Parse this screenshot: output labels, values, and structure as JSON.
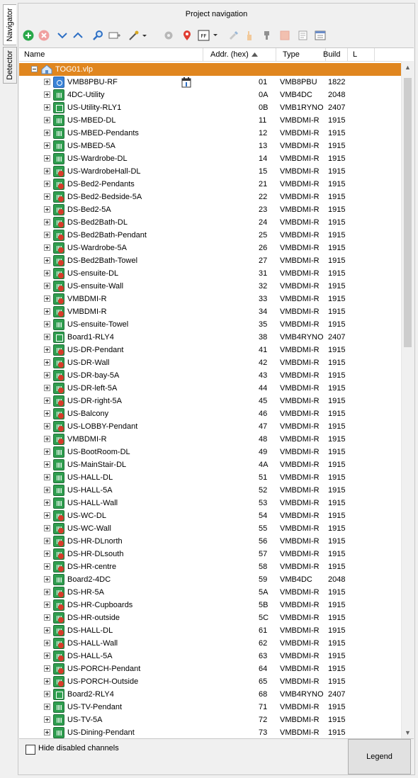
{
  "side_tabs": [
    "Navigator",
    "Detector"
  ],
  "panel_title": "Project navigation",
  "toolbar": {
    "icons": [
      "add-icon",
      "delete-icon",
      "move-down-icon",
      "move-up-icon",
      "search-icon",
      "scan-icon",
      "wand-icon",
      "gear-icon",
      "location-pin-icon",
      "firmware-icon",
      "brush-icon",
      "hand-icon",
      "stamp-icon",
      "memory-icon",
      "edit-form-icon",
      "print-window-icon"
    ],
    "ff_label": "FF"
  },
  "columns": {
    "name": "Name",
    "addr": "Addr. (hex)",
    "type": "Type",
    "build": "Build",
    "l": "L"
  },
  "root": {
    "name": "TOG01.vlp"
  },
  "rows": [
    {
      "name": "VMB8PBU-RF",
      "addr": "01",
      "type": "VMB8PBU",
      "build": "1822",
      "icon": "pbu",
      "cal": true
    },
    {
      "name": "4DC-Utility",
      "addr": "0A",
      "type": "VMB4DC",
      "build": "2048",
      "icon": "dim"
    },
    {
      "name": "US-Utility-RLY1",
      "addr": "0B",
      "type": "VMB1RYNO",
      "build": "2407",
      "icon": "rly"
    },
    {
      "name": "US-MBED-DL",
      "addr": "11",
      "type": "VMBDMI-R",
      "build": "1915",
      "icon": "dim"
    },
    {
      "name": "US-MBED-Pendants",
      "addr": "12",
      "type": "VMBDMI-R",
      "build": "1915",
      "icon": "dim"
    },
    {
      "name": "US-MBED-5A",
      "addr": "13",
      "type": "VMBDMI-R",
      "build": "1915",
      "icon": "dim"
    },
    {
      "name": "US-Wardrobe-DL",
      "addr": "14",
      "type": "VMBDMI-R",
      "build": "1915",
      "icon": "dim"
    },
    {
      "name": "US-WardrobeHall-DL",
      "addr": "15",
      "type": "VMBDMI-R",
      "build": "1915",
      "icon": "dimred"
    },
    {
      "name": "DS-Bed2-Pendants",
      "addr": "21",
      "type": "VMBDMI-R",
      "build": "1915",
      "icon": "dimred"
    },
    {
      "name": "DS-Bed2-Bedside-5A",
      "addr": "22",
      "type": "VMBDMI-R",
      "build": "1915",
      "icon": "dimred"
    },
    {
      "name": "DS-Bed2-5A",
      "addr": "23",
      "type": "VMBDMI-R",
      "build": "1915",
      "icon": "dimred"
    },
    {
      "name": "DS-Bed2Bath-DL",
      "addr": "24",
      "type": "VMBDMI-R",
      "build": "1915",
      "icon": "dimred"
    },
    {
      "name": "DS-Bed2Bath-Pendant",
      "addr": "25",
      "type": "VMBDMI-R",
      "build": "1915",
      "icon": "dimred"
    },
    {
      "name": "US-Wardrobe-5A",
      "addr": "26",
      "type": "VMBDMI-R",
      "build": "1915",
      "icon": "dimred"
    },
    {
      "name": "DS-Bed2Bath-Towel",
      "addr": "27",
      "type": "VMBDMI-R",
      "build": "1915",
      "icon": "dimred"
    },
    {
      "name": "US-ensuite-DL",
      "addr": "31",
      "type": "VMBDMI-R",
      "build": "1915",
      "icon": "dimred"
    },
    {
      "name": "US-ensuite-Wall",
      "addr": "32",
      "type": "VMBDMI-R",
      "build": "1915",
      "icon": "dimred"
    },
    {
      "name": "VMBDMI-R",
      "addr": "33",
      "type": "VMBDMI-R",
      "build": "1915",
      "icon": "dimred"
    },
    {
      "name": "VMBDMI-R",
      "addr": "34",
      "type": "VMBDMI-R",
      "build": "1915",
      "icon": "dimred"
    },
    {
      "name": "US-ensuite-Towel",
      "addr": "35",
      "type": "VMBDMI-R",
      "build": "1915",
      "icon": "dim"
    },
    {
      "name": "Board1-RLY4",
      "addr": "38",
      "type": "VMB4RYNO",
      "build": "2407",
      "icon": "rly"
    },
    {
      "name": "US-DR-Pendant",
      "addr": "41",
      "type": "VMBDMI-R",
      "build": "1915",
      "icon": "dimred"
    },
    {
      "name": "US-DR-Wall",
      "addr": "42",
      "type": "VMBDMI-R",
      "build": "1915",
      "icon": "dimred"
    },
    {
      "name": "US-DR-bay-5A",
      "addr": "43",
      "type": "VMBDMI-R",
      "build": "1915",
      "icon": "dimred"
    },
    {
      "name": "US-DR-left-5A",
      "addr": "44",
      "type": "VMBDMI-R",
      "build": "1915",
      "icon": "dimred"
    },
    {
      "name": "US-DR-right-5A",
      "addr": "45",
      "type": "VMBDMI-R",
      "build": "1915",
      "icon": "dimred"
    },
    {
      "name": "US-Balcony",
      "addr": "46",
      "type": "VMBDMI-R",
      "build": "1915",
      "icon": "dimred"
    },
    {
      "name": "US-LOBBY-Pendant",
      "addr": "47",
      "type": "VMBDMI-R",
      "build": "1915",
      "icon": "dimred"
    },
    {
      "name": "VMBDMI-R",
      "addr": "48",
      "type": "VMBDMI-R",
      "build": "1915",
      "icon": "dimred"
    },
    {
      "name": "US-BootRoom-DL",
      "addr": "49",
      "type": "VMBDMI-R",
      "build": "1915",
      "icon": "dim"
    },
    {
      "name": "US-MainStair-DL",
      "addr": "4A",
      "type": "VMBDMI-R",
      "build": "1915",
      "icon": "dim"
    },
    {
      "name": "US-HALL-DL",
      "addr": "51",
      "type": "VMBDMI-R",
      "build": "1915",
      "icon": "dim"
    },
    {
      "name": "US-HALL-5A",
      "addr": "52",
      "type": "VMBDMI-R",
      "build": "1915",
      "icon": "dim"
    },
    {
      "name": "US-HALL-Wall",
      "addr": "53",
      "type": "VMBDMI-R",
      "build": "1915",
      "icon": "dim"
    },
    {
      "name": "US-WC-DL",
      "addr": "54",
      "type": "VMBDMI-R",
      "build": "1915",
      "icon": "dimred"
    },
    {
      "name": "US-WC-Wall",
      "addr": "55",
      "type": "VMBDMI-R",
      "build": "1915",
      "icon": "dimred"
    },
    {
      "name": "DS-HR-DLnorth",
      "addr": "56",
      "type": "VMBDMI-R",
      "build": "1915",
      "icon": "dimred"
    },
    {
      "name": "DS-HR-DLsouth",
      "addr": "57",
      "type": "VMBDMI-R",
      "build": "1915",
      "icon": "dimred"
    },
    {
      "name": "DS-HR-centre",
      "addr": "58",
      "type": "VMBDMI-R",
      "build": "1915",
      "icon": "dimred"
    },
    {
      "name": "Board2-4DC",
      "addr": "59",
      "type": "VMB4DC",
      "build": "2048",
      "icon": "dim"
    },
    {
      "name": "DS-HR-5A",
      "addr": "5A",
      "type": "VMBDMI-R",
      "build": "1915",
      "icon": "dimred"
    },
    {
      "name": "DS-HR-Cupboards",
      "addr": "5B",
      "type": "VMBDMI-R",
      "build": "1915",
      "icon": "dimred"
    },
    {
      "name": "DS-HR-outside",
      "addr": "5C",
      "type": "VMBDMI-R",
      "build": "1915",
      "icon": "dimred"
    },
    {
      "name": "DS-HALL-DL",
      "addr": "61",
      "type": "VMBDMI-R",
      "build": "1915",
      "icon": "dimred"
    },
    {
      "name": "DS-HALL-Wall",
      "addr": "62",
      "type": "VMBDMI-R",
      "build": "1915",
      "icon": "dimred"
    },
    {
      "name": "DS-HALL-5A",
      "addr": "63",
      "type": "VMBDMI-R",
      "build": "1915",
      "icon": "dimred"
    },
    {
      "name": "US-PORCH-Pendant",
      "addr": "64",
      "type": "VMBDMI-R",
      "build": "1915",
      "icon": "dimred"
    },
    {
      "name": "US-PORCH-Outside",
      "addr": "65",
      "type": "VMBDMI-R",
      "build": "1915",
      "icon": "dimred"
    },
    {
      "name": "Board2-RLY4",
      "addr": "68",
      "type": "VMB4RYNO",
      "build": "2407",
      "icon": "rly"
    },
    {
      "name": "US-TV-Pendant",
      "addr": "71",
      "type": "VMBDMI-R",
      "build": "1915",
      "icon": "dim"
    },
    {
      "name": "US-TV-5A",
      "addr": "72",
      "type": "VMBDMI-R",
      "build": "1915",
      "icon": "dim"
    },
    {
      "name": "US-Dining-Pendant",
      "addr": "73",
      "type": "VMBDMI-R",
      "build": "1915",
      "icon": "dim"
    }
  ],
  "bottom": {
    "hide_disabled_label": "Hide disabled channels",
    "hide_disabled_checked": false,
    "legend_label": "Legend"
  },
  "colors": {
    "selection": "#e0861f",
    "dimmer_green": "#2f9e4f",
    "pbu_blue": "#3b84d8",
    "indicator_red": "#d83a2a"
  }
}
